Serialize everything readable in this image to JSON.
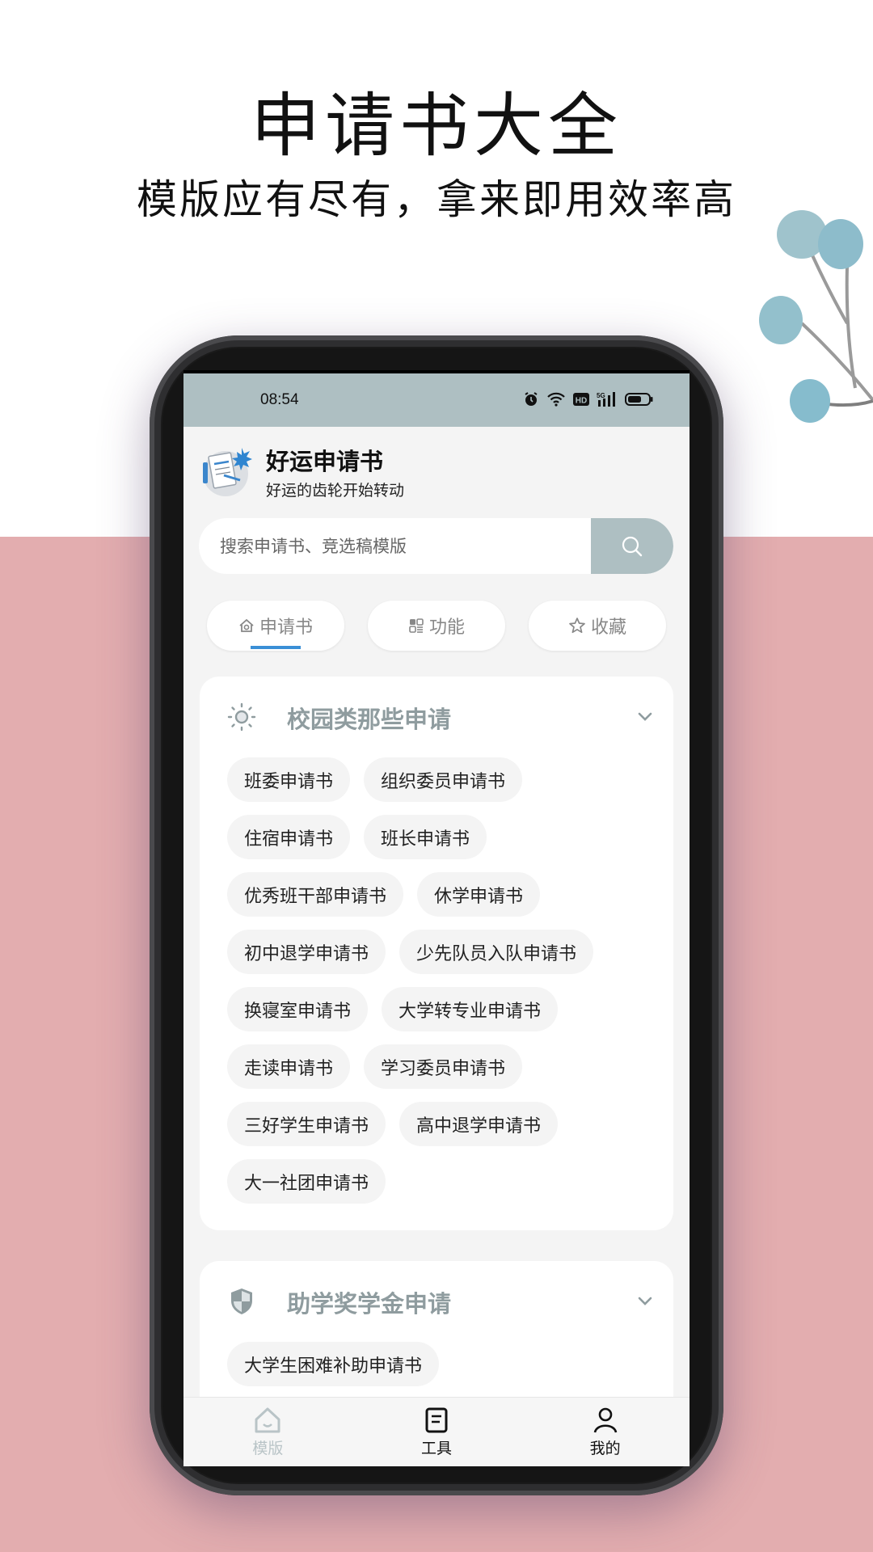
{
  "promo": {
    "title": "申请书大全",
    "subtitle": "模版应有尽有，拿来即用效率高"
  },
  "colors": {
    "pink_bg": "#e3adaf",
    "status_bar": "#aebfc2",
    "accent_underline": "#3a8fd6",
    "card_title": "#8f9c9f"
  },
  "status_bar": {
    "time": "08:54",
    "icons": [
      "alarm-icon",
      "wifi-icon",
      "hd-icon",
      "5g-signal-icon",
      "battery-icon"
    ],
    "network": "5G",
    "hd": "HD"
  },
  "app": {
    "name": "好运申请书",
    "slogan": "好运的齿轮开始转动",
    "logo": "document-signing-logo"
  },
  "search": {
    "placeholder": "搜索申请书、竞选稿模版",
    "value": "",
    "button_icon": "search-icon"
  },
  "tabs": [
    {
      "label": "申请书",
      "icon": "home-icon",
      "active": true
    },
    {
      "label": "功能",
      "icon": "grid-icon",
      "active": false
    },
    {
      "label": "收藏",
      "icon": "star-icon",
      "active": false
    }
  ],
  "sections": [
    {
      "title": "校园类那些申请",
      "icon": "sun-icon",
      "expanded": true,
      "items": [
        "班委申请书",
        "组织委员申请书",
        "住宿申请书",
        "班长申请书",
        "优秀班干部申请书",
        "休学申请书",
        "初中退学申请书",
        "少先队员入队申请书",
        "换寝室申请书",
        "大学转专业申请书",
        "走读申请书",
        "学习委员申请书",
        "三好学生申请书",
        "高中退学申请书",
        "大一社团申请书"
      ]
    },
    {
      "title": "助学奖学金申请",
      "icon": "shield-icon",
      "expanded": true,
      "items": [
        "大学生困难补助申请书"
      ]
    }
  ],
  "bottom_nav": [
    {
      "label": "模版",
      "icon": "home-icon",
      "active": false
    },
    {
      "label": "工具",
      "icon": "notepad-icon",
      "active": true
    },
    {
      "label": "我的",
      "icon": "user-icon",
      "active": true
    }
  ]
}
